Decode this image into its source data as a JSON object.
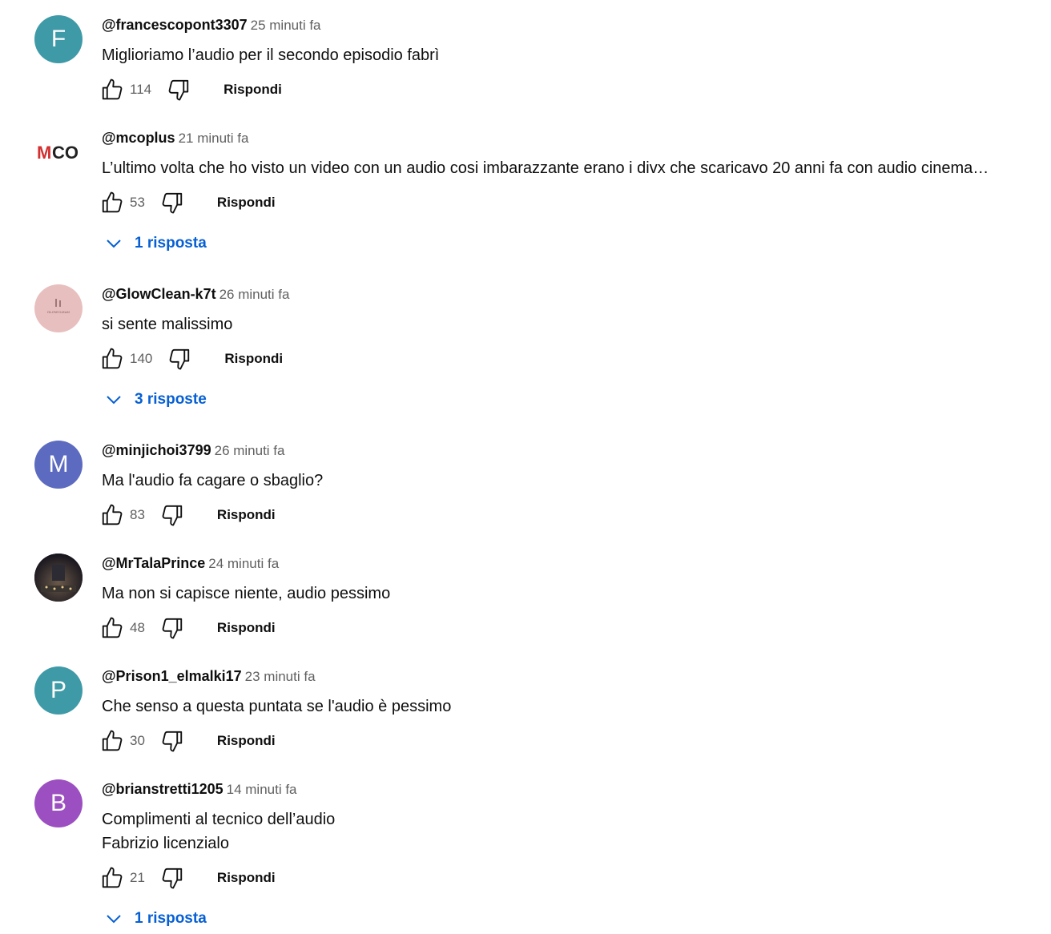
{
  "comments": [
    {
      "avatar_letter": "F",
      "avatar_color": "#3f9aa8",
      "author": "@francescopont3307",
      "time": "25 minuti fa",
      "text": "Miglioriamo l’audio per il secondo episodio fabrì",
      "likes": "114",
      "reply_label": "Rispondi"
    },
    {
      "avatar_logo": "MCO",
      "author": "@mcoplus",
      "time": "21 minuti fa",
      "text": "L’ultimo volta che ho visto un video con un audio cosi imbarazzante erano i divx che scaricavo 20 anni fa con audio cinema…",
      "likes": "53",
      "reply_label": "Rispondi",
      "replies_label": "1 risposta"
    },
    {
      "avatar_color": "#e8bfbf",
      "avatar_logo": "GLOWCLEAN",
      "author": "@GlowClean-k7t",
      "time": "26 minuti fa",
      "text": "si sente malissimo",
      "likes": "140",
      "reply_label": "Rispondi",
      "replies_label": "3 risposte"
    },
    {
      "avatar_letter": "M",
      "avatar_color": "#5c6bc0",
      "author": "@minjichoi3799",
      "time": "26 minuti fa",
      "text": "Ma l'audio fa cagare o sbaglio?",
      "likes": "83",
      "reply_label": "Rispondi"
    },
    {
      "avatar_color": "#1c1a24",
      "author": "@MrTalaPrince",
      "time": "24 minuti fa",
      "text": "Ma non si capisce niente, audio pessimo",
      "likes": "48",
      "reply_label": "Rispondi"
    },
    {
      "avatar_letter": "P",
      "avatar_color": "#3f9aa8",
      "author": "@Prison1_elmalki17",
      "time": "23 minuti fa",
      "text": "Che senso a questa puntata se l'audio è pessimo",
      "likes": "30",
      "reply_label": "Rispondi"
    },
    {
      "avatar_letter": "B",
      "avatar_color": "#9c4fc0",
      "author": "@brianstretti1205",
      "time": "14 minuti fa",
      "text": "Complimenti al tecnico dell’audio",
      "text2": "Fabrizio licenzialo",
      "likes": "21",
      "reply_label": "Rispondi",
      "replies_label": "1 risposta"
    }
  ],
  "colors": {
    "link": "#065fd4",
    "secondary": "#606060",
    "primary": "#0f0f0f"
  },
  "icons": {
    "like": "thumb-up-icon",
    "dislike": "thumb-down-icon",
    "expand": "chevron-down-icon"
  }
}
